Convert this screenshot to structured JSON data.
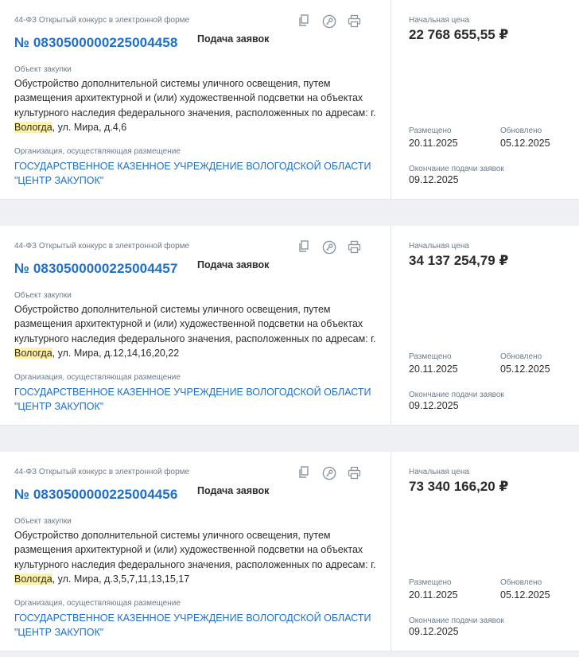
{
  "cards": [
    {
      "law_type": "44-ФЗ Открытый конкурс в электронной форме",
      "reg_number": "№ 0830500000225004458",
      "status": "Подача заявок",
      "object_label": "Объект закупки",
      "object_text_before": "Обустройство дополнительной системы уличного освещения, путем размещения архитектурной и (или) художественной подсветки на объектах культурного наследия федерального значения, расположенных по адресам: г. ",
      "object_highlight": "Вологда",
      "object_text_after": ", ул. Мира, д.4,6",
      "org_label": "Организация, осуществляющая размещение",
      "org_name": "ГОСУДАРСТВЕННОЕ КАЗЕННОЕ УЧРЕЖДЕНИЕ ВОЛОГОДСКОЙ ОБЛАСТИ \"ЦЕНТР ЗАКУПОК\"",
      "price_label": "Начальная цена",
      "price": "22 768 655,55 ₽",
      "posted_label": "Размещено",
      "posted_date": "20.11.2025",
      "updated_label": "Обновлено",
      "updated_date": "05.12.2025",
      "deadline_label": "Окончание подачи заявок",
      "deadline_date": "09.12.2025"
    },
    {
      "law_type": "44-ФЗ Открытый конкурс в электронной форме",
      "reg_number": "№ 0830500000225004457",
      "status": "Подача заявок",
      "object_label": "Объект закупки",
      "object_text_before": "Обустройство дополнительной системы уличного освещения, путем размещения архитектурной и (или) художественной подсветки на объектах культурного наследия федерального значения, расположенных по адресам: г. ",
      "object_highlight": "Вологда",
      "object_text_after": ", ул. Мира, д.12,14,16,20,22",
      "org_label": "Организация, осуществляющая размещение",
      "org_name": "ГОСУДАРСТВЕННОЕ КАЗЕННОЕ УЧРЕЖДЕНИЕ ВОЛОГОДСКОЙ ОБЛАСТИ \"ЦЕНТР ЗАКУПОК\"",
      "price_label": "Начальная цена",
      "price": "34 137 254,79 ₽",
      "posted_label": "Размещено",
      "posted_date": "20.11.2025",
      "updated_label": "Обновлено",
      "updated_date": "05.12.2025",
      "deadline_label": "Окончание подачи заявок",
      "deadline_date": "09.12.2025"
    },
    {
      "law_type": "44-ФЗ Открытый конкурс в электронной форме",
      "reg_number": "№ 0830500000225004456",
      "status": "Подача заявок",
      "object_label": "Объект закупки",
      "object_text_before": "Обустройство дополнительной системы уличного освещения, путем размещения архитектурной и (или) художественной подсветки на объектах культурного наследия федерального значения, расположенных по адресам: г. ",
      "object_highlight": "Вологда",
      "object_text_after": ", ул. Мира, д.3,5,7,11,13,15,17",
      "org_label": "Организация, осуществляющая размещение",
      "org_name": "ГОСУДАРСТВЕННОЕ КАЗЕННОЕ УЧРЕЖДЕНИЕ ВОЛОГОДСКОЙ ОБЛАСТИ \"ЦЕНТР ЗАКУПОК\"",
      "price_label": "Начальная цена",
      "price": "73 340 166,20 ₽",
      "posted_label": "Размещено",
      "posted_date": "20.11.2025",
      "updated_label": "Обновлено",
      "updated_date": "05.12.2025",
      "deadline_label": "Окончание подачи заявок",
      "deadline_date": "09.12.2025"
    }
  ],
  "icons": [
    "copy-icon",
    "key-icon",
    "print-icon"
  ],
  "colors": {
    "link": "#1f6fc7",
    "highlight": "#fff2a8",
    "muted": "#6a7a8c",
    "background": "#eef0f4"
  }
}
